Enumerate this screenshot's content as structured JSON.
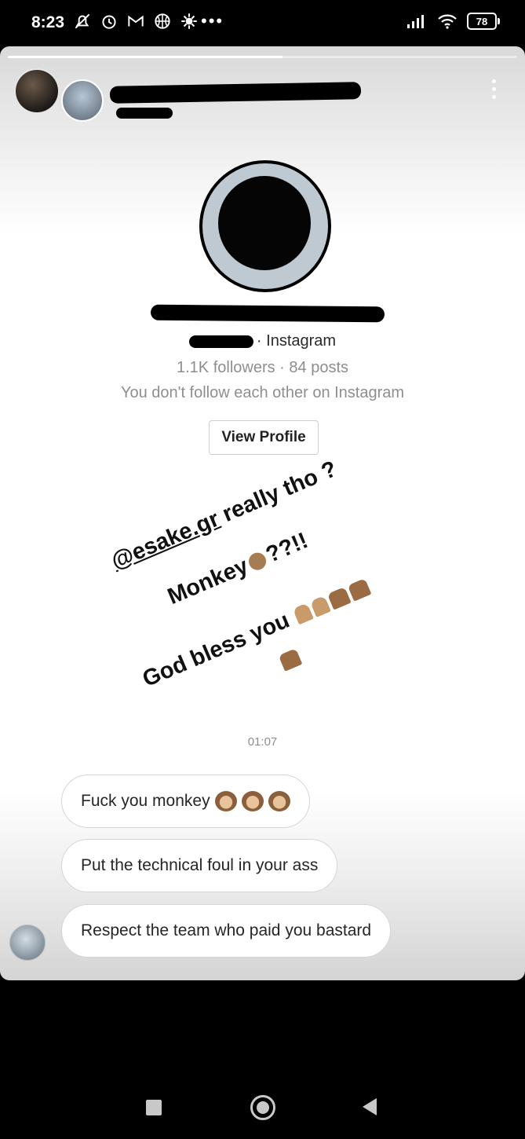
{
  "status_bar": {
    "time": "8:23",
    "overflow": "•••",
    "battery": "78",
    "icons": [
      "muted-bell-icon",
      "alarm-icon",
      "gmail-icon",
      "basketball-icon",
      "settings-gear-icon",
      "signal-icon",
      "wifi-icon",
      "battery-icon"
    ]
  },
  "story": {
    "progress": 0.54,
    "menu_icon": "more-vertical-icon"
  },
  "shared_profile": {
    "platform": "· Instagram",
    "stats": "1.1K followers · 84 posts",
    "follow_status": "You don't follow each other on Instagram",
    "view_profile_label": "View Profile"
  },
  "story_text": {
    "mention": "@esake.gr",
    "line1_rest": " really tho ?",
    "line2_word": "Monkey",
    "line2_end": "??!!",
    "line3": "God bless you"
  },
  "conversation": {
    "timestamp": "01:07",
    "messages": [
      "Fuck you monkey",
      "Put the technical foul in your ass",
      "Respect the team who paid you bastard"
    ]
  },
  "nav_bar": {
    "icons": [
      "recents-square-icon",
      "home-circle-icon",
      "back-triangle-icon"
    ]
  }
}
